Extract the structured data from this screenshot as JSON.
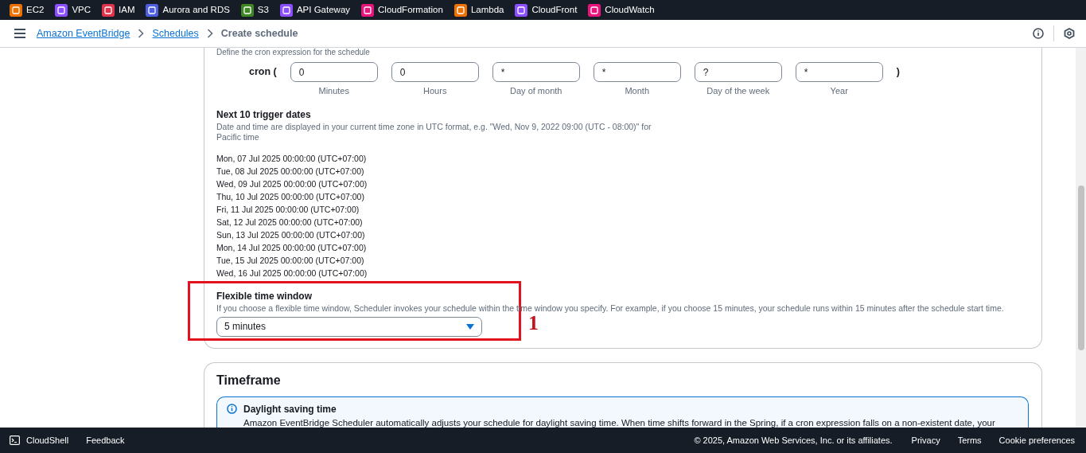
{
  "services": [
    {
      "label": "EC2",
      "color": "#ed7100"
    },
    {
      "label": "VPC",
      "color": "#8c4fff"
    },
    {
      "label": "IAM",
      "color": "#dd344c"
    },
    {
      "label": "Aurora and RDS",
      "color": "#4d5fe0"
    },
    {
      "label": "S3",
      "color": "#3f8624"
    },
    {
      "label": "API Gateway",
      "color": "#8c4fff"
    },
    {
      "label": "CloudFormation",
      "color": "#e7157b"
    },
    {
      "label": "Lambda",
      "color": "#ed7100"
    },
    {
      "label": "CloudFront",
      "color": "#8c4fff"
    },
    {
      "label": "CloudWatch",
      "color": "#e7157b"
    }
  ],
  "breadcrumb": [
    {
      "label": "Amazon EventBridge",
      "kind": "link"
    },
    {
      "label": "Schedules",
      "kind": "link"
    },
    {
      "label": "Create schedule",
      "kind": "current"
    }
  ],
  "cron": {
    "description": "Define the cron expression for the schedule",
    "open": "cron (",
    "close": ")",
    "fields": [
      {
        "value": "0",
        "label": "Minutes"
      },
      {
        "value": "0",
        "label": "Hours"
      },
      {
        "value": "*",
        "label": "Day of month"
      },
      {
        "value": "*",
        "label": "Month"
      },
      {
        "value": "?",
        "label": "Day of the week"
      },
      {
        "value": "*",
        "label": "Year"
      }
    ]
  },
  "trigger_dates": {
    "title": "Next 10 trigger dates",
    "description": "Date and time are displayed in your current time zone in UTC format, e.g. \"Wed, Nov 9, 2022 09:00 (UTC - 08:00)\" for Pacific time",
    "dates": [
      "Mon, 07 Jul 2025 00:00:00 (UTC+07:00)",
      "Tue, 08 Jul 2025 00:00:00 (UTC+07:00)",
      "Wed, 09 Jul 2025 00:00:00 (UTC+07:00)",
      "Thu, 10 Jul 2025 00:00:00 (UTC+07:00)",
      "Fri, 11 Jul 2025 00:00:00 (UTC+07:00)",
      "Sat, 12 Jul 2025 00:00:00 (UTC+07:00)",
      "Sun, 13 Jul 2025 00:00:00 (UTC+07:00)",
      "Mon, 14 Jul 2025 00:00:00 (UTC+07:00)",
      "Tue, 15 Jul 2025 00:00:00 (UTC+07:00)",
      "Wed, 16 Jul 2025 00:00:00 (UTC+07:00)"
    ]
  },
  "flexible_window": {
    "title": "Flexible time window",
    "description": "If you choose a flexible time window, Scheduler invokes your schedule within the time window you specify. For example, if you choose 15 minutes, your schedule runs within 15 minutes after the schedule start time.",
    "value": "5 minutes"
  },
  "annotation": {
    "label": "1"
  },
  "timeframe": {
    "title": "Timeframe",
    "alert": {
      "title": "Daylight saving time",
      "text": "Amazon EventBridge Scheduler automatically adjusts your schedule for daylight saving time. When time shifts forward in the Spring, if a cron expression falls on a non-existent date, your"
    }
  },
  "footer": {
    "cloudshell": "CloudShell",
    "feedback": "Feedback",
    "copyright": "© 2025, Amazon Web Services, Inc. or its affiliates.",
    "links": [
      "Privacy",
      "Terms",
      "Cookie preferences"
    ]
  }
}
